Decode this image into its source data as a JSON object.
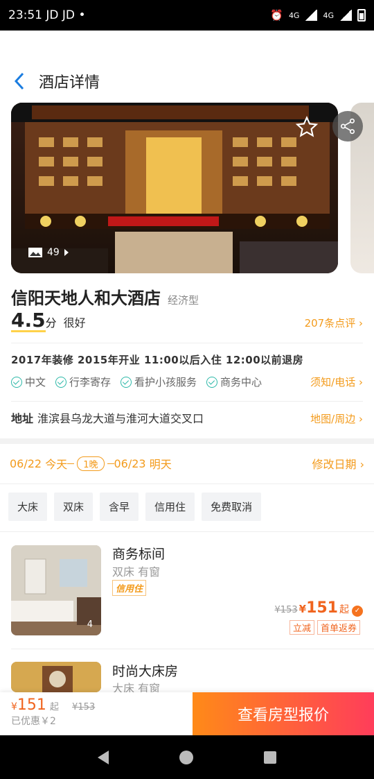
{
  "status_bar": {
    "time": "23:51",
    "carrier": "JD JD",
    "dot": "•",
    "net1": "4G",
    "net2": "4G"
  },
  "header": {
    "title": "酒店详情"
  },
  "gallery": {
    "photo_count": "49"
  },
  "hotel": {
    "name": "信阳天地人和大酒店",
    "type": "经济型",
    "score": "4.5",
    "score_unit": "分",
    "score_text": "很好",
    "reviews": "207条点评",
    "info_line": "2017年装修  2015年开业  11:00以后入住 12:00以前退房",
    "facilities": [
      "中文",
      "行李寄存",
      "看护小孩服务",
      "商务中心"
    ],
    "notice": "须知/电话",
    "address_label": "地址",
    "address": "淮滨县乌龙大道与淮河大道交叉口",
    "map": "地图/周边"
  },
  "dates": {
    "checkin": "06/22",
    "checkin_day": "今天",
    "nights": "1晚",
    "checkout": "06/23",
    "checkout_day": "明天",
    "modify": "修改日期"
  },
  "filters": [
    "大床",
    "双床",
    "含早",
    "信用住",
    "免费取消"
  ],
  "rooms": [
    {
      "name": "商务标间",
      "sub": "双床 有窗",
      "tag": "信用住",
      "old_price": "¥153",
      "price_yen": "¥",
      "price": "151",
      "qi": "起",
      "badge": "✓",
      "promos": [
        "立减",
        "首单返券"
      ],
      "img_count": "4"
    },
    {
      "name": "时尚大床房",
      "sub": "大床 有窗"
    }
  ],
  "bottom_bar": {
    "price_yen": "¥",
    "price": "151",
    "qi": "起",
    "old_price": "¥153",
    "saved": "已优惠￥2",
    "cta": "查看房型报价"
  }
}
